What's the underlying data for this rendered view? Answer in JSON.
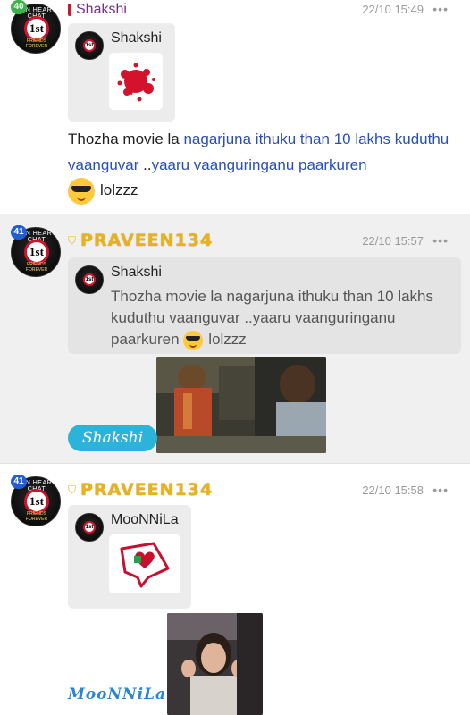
{
  "messages": [
    {
      "badge": "40",
      "user": "Shakshi",
      "time": "22/10 15:49",
      "more": "•••",
      "quote": {
        "user": "Shakshi"
      },
      "text_parts": [
        "Thozha movie la ",
        "nagarjuna ithuku than 10 lakhs kuduthu vaanguvar",
        " ..",
        "yaaru vaanguringanu paarkuren"
      ],
      "text_end": "lolzzz"
    },
    {
      "badge": "41",
      "user": "PRAVEEN134",
      "time": "22/10 15:57",
      "more": "•••",
      "quote": {
        "user": "Shakshi",
        "text": "Thozha movie la nagarjuna ithuku than 10 lakhs kuduthu vaanguvar ..yaaru vaanguringanu paarkuren",
        "text_end": "lolzzz"
      },
      "mention": "Shakshi"
    },
    {
      "badge": "41",
      "user": "PRAVEEN134",
      "time": "22/10 15:58",
      "more": "•••",
      "quote": {
        "user": "MooNNiLa"
      },
      "mention": "MooNNiLa"
    }
  ],
  "avatar": {
    "ring_top": "FAN HEART CHAT",
    "center": "1st",
    "ring_bottom": "FRIENDS FOREVER"
  },
  "colors": {
    "link": "#2a4fb8",
    "mention_pill": "#2bb3d9",
    "gold_name": "#e8b21a",
    "purple_name": "#7a2d8c"
  }
}
